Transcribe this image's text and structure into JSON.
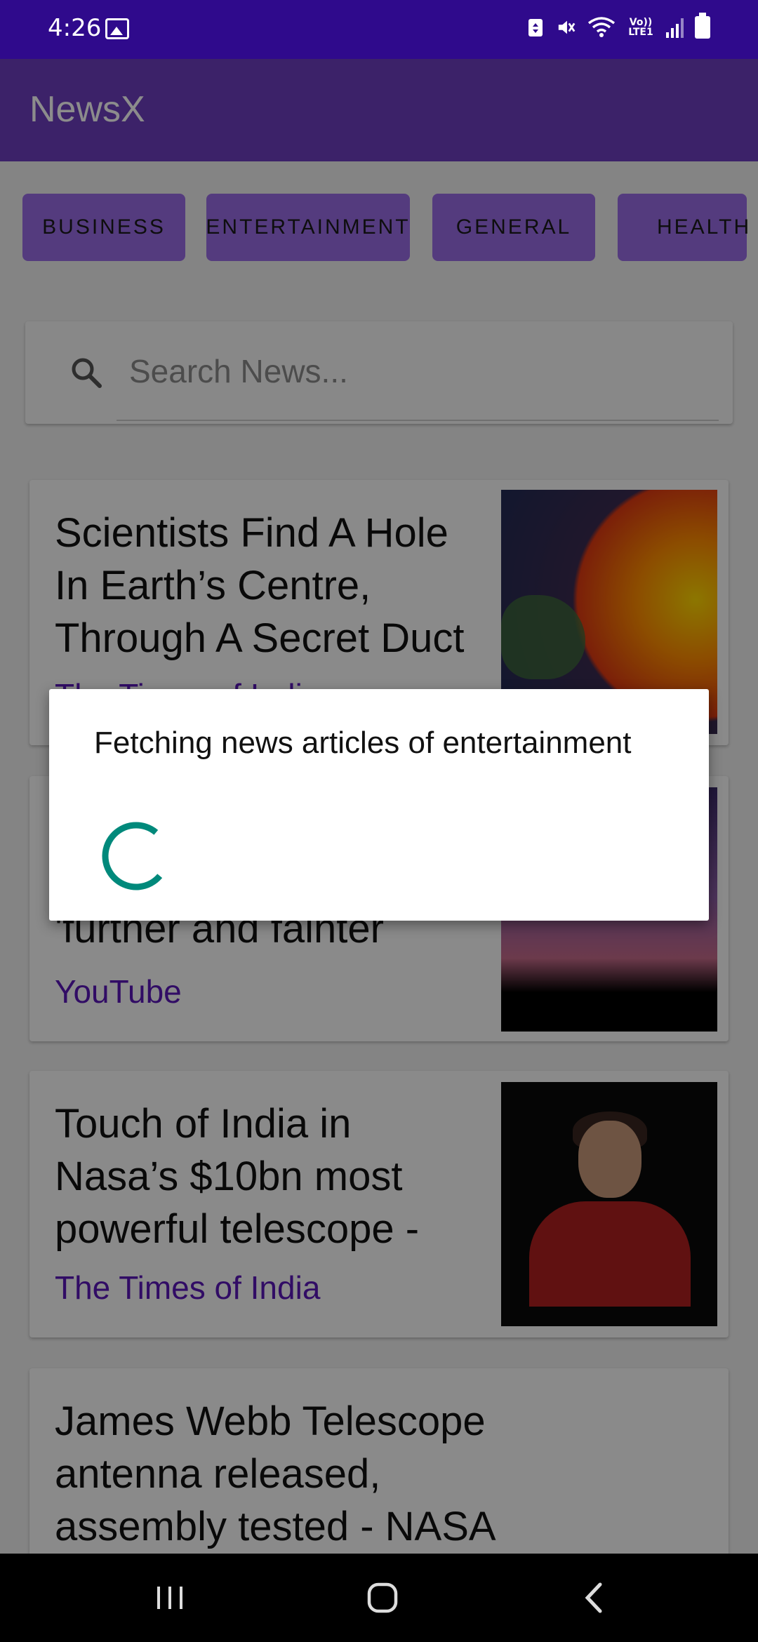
{
  "status_bar": {
    "time": "4:26",
    "icons": [
      "image-icon",
      "battery-saver-icon",
      "mute-icon",
      "wifi-icon",
      "volte-icon",
      "signal-icon",
      "battery-icon"
    ],
    "volte_label": "Vo))\nLTE1"
  },
  "app_bar": {
    "title": "NewsX"
  },
  "categories": [
    "BUSINESS",
    "ENTERTAINMENT",
    "GENERAL",
    "HEALTH"
  ],
  "search": {
    "placeholder": "Search News..."
  },
  "articles": [
    {
      "title": "Scientists Find A Hole In Earth’s Centre, Through A Secret Duct Under",
      "source": "The Times of India"
    },
    {
      "title": "'further and fainter",
      "source": "YouTube"
    },
    {
      "title": "Touch of India in Nasa’s $10bn most powerful telescope - Times of",
      "source": "The Times of India"
    },
    {
      "title": "James Webb Telescope antenna released, assembly tested - NASA",
      "source": ""
    }
  ],
  "dialog": {
    "message": "Fetching news articles of entertainment"
  },
  "colors": {
    "primary": "#6d3fc0",
    "status_bar": "#2f0a8c",
    "chip": "#9a6ce6",
    "source_text": "#5a16b8",
    "spinner": "#00897b"
  }
}
